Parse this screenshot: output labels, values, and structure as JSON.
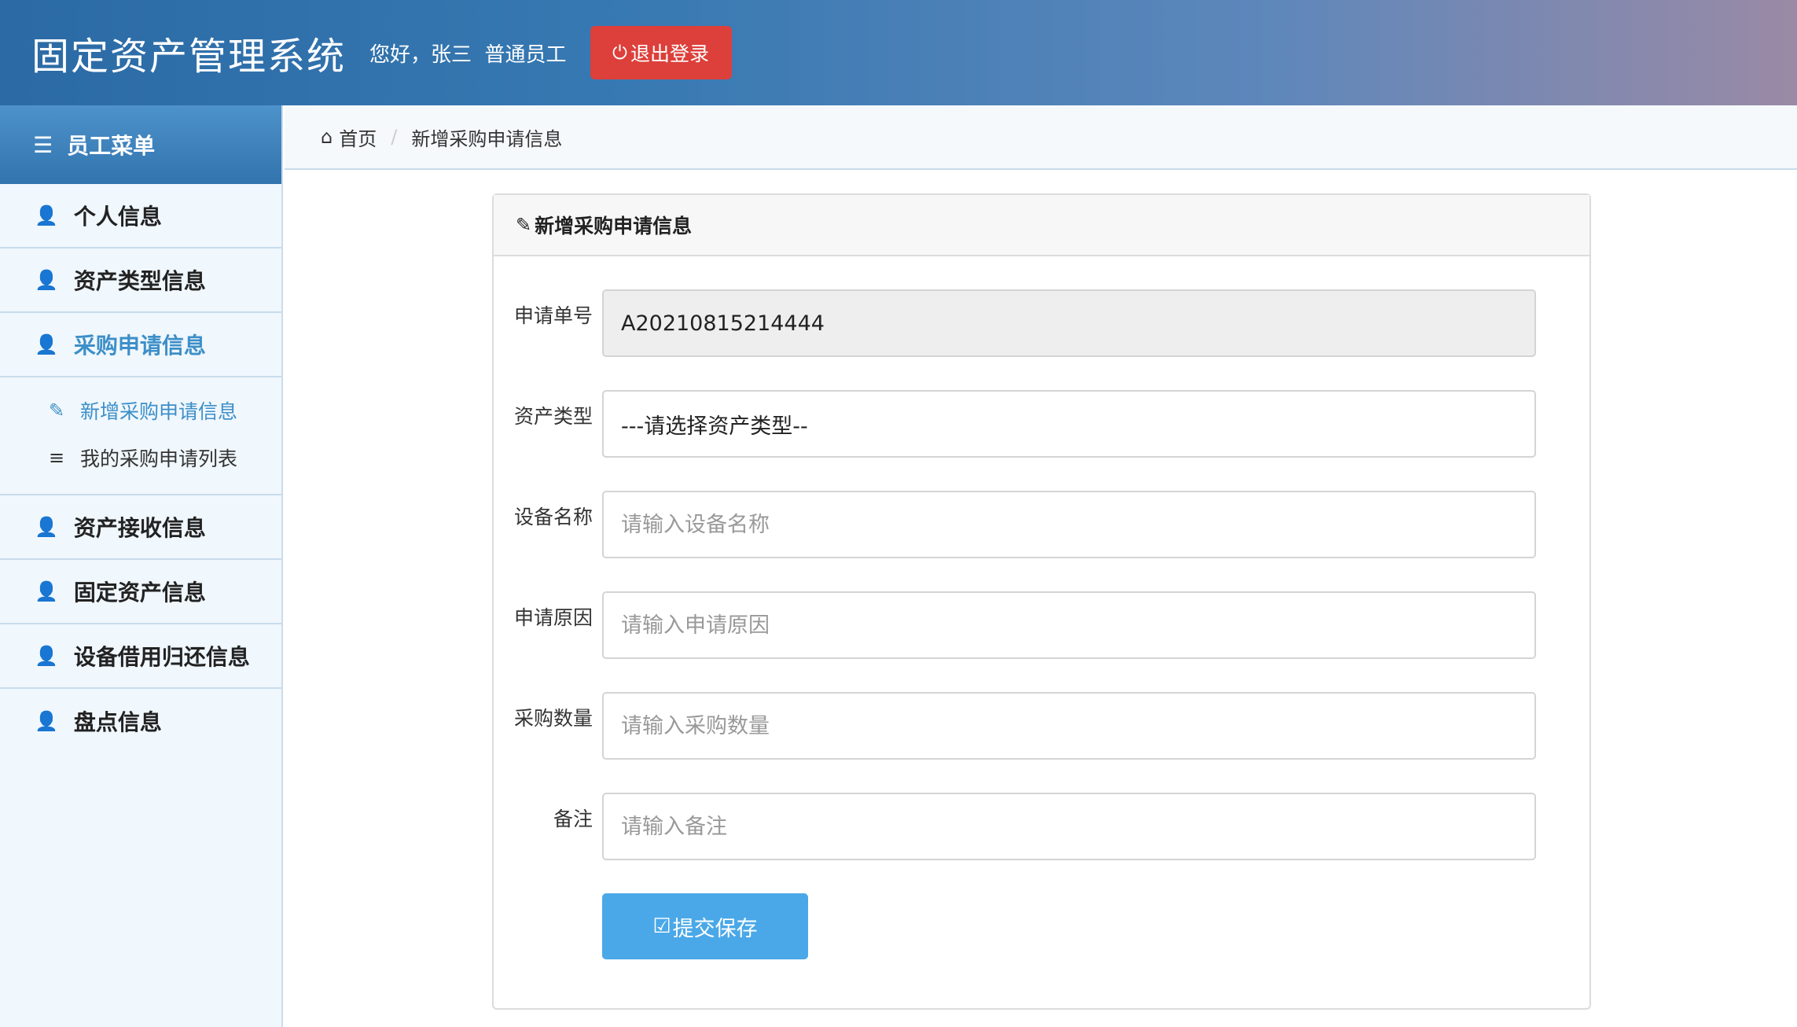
{
  "header": {
    "title": "固定资产管理系统",
    "greeting": "您好，张三  普通员工",
    "logout_label": "退出登录",
    "logout_icon": "power-icon"
  },
  "sidebar": {
    "heading": "员工菜单",
    "items": [
      {
        "label": "个人信息"
      },
      {
        "label": "资产类型信息"
      },
      {
        "label": "采购申请信息"
      },
      {
        "label": "资产接收信息"
      },
      {
        "label": "固定资产信息"
      },
      {
        "label": "设备借用归还信息"
      },
      {
        "label": "盘点信息"
      }
    ],
    "subitems": [
      {
        "label": "新增采购申请信息"
      },
      {
        "label": "我的采购申请列表"
      }
    ]
  },
  "breadcrumb": {
    "home": "首页",
    "current": "新增采购申请信息"
  },
  "panel": {
    "title": "新增采购申请信息"
  },
  "form": {
    "order_no": {
      "label": "申请单号",
      "value": "A20210815214444"
    },
    "asset_type": {
      "label": "资产类型",
      "value": "---请选择资产类型--"
    },
    "device_name": {
      "label": "设备名称",
      "placeholder": "请输入设备名称"
    },
    "reason": {
      "label": "申请原因",
      "placeholder": "请输入申请原因"
    },
    "quantity": {
      "label": "采购数量",
      "placeholder": "请输入采购数量"
    },
    "remark": {
      "label": "备注",
      "placeholder": "请输入备注"
    },
    "submit_label": "提交保存"
  },
  "colors": {
    "accent": "#3d8fc8",
    "logout": "#dd3f3a",
    "submit": "#4aa8e8"
  }
}
